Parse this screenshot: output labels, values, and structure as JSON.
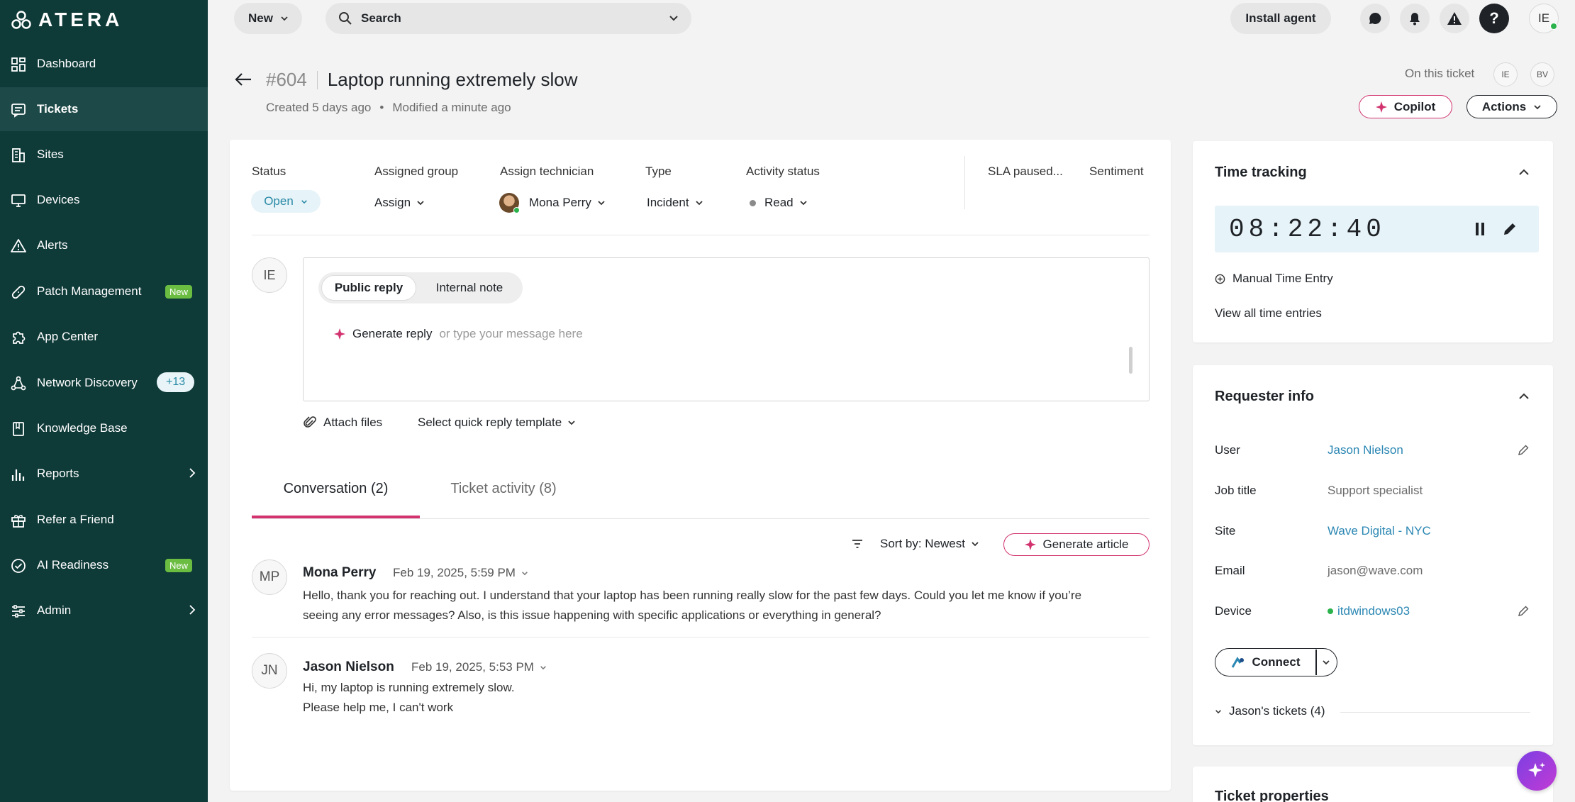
{
  "app": {
    "logo_text": "ATERA"
  },
  "sidebar": {
    "items": [
      {
        "label": "Dashboard"
      },
      {
        "label": "Tickets"
      },
      {
        "label": "Sites"
      },
      {
        "label": "Devices"
      },
      {
        "label": "Alerts"
      },
      {
        "label": "Patch Management",
        "badge": "New"
      },
      {
        "label": "App Center"
      },
      {
        "label": "Network Discovery",
        "badge": "+13"
      },
      {
        "label": "Knowledge Base"
      },
      {
        "label": "Reports"
      },
      {
        "label": "Refer a Friend"
      },
      {
        "label": "AI Readiness",
        "badge": "New"
      },
      {
        "label": "Admin"
      }
    ]
  },
  "topbar": {
    "new_label": "New",
    "search_label": "Search",
    "install_agent": "Install agent",
    "help_glyph": "?",
    "user_initials": "IE"
  },
  "ticket": {
    "number": "#604",
    "title": "Laptop running extremely slow",
    "created": "Created 5 days ago",
    "separator": "•",
    "modified": "Modified a minute ago",
    "on_this_ticket": "On this ticket",
    "viewers": [
      "IE",
      "BV"
    ],
    "copilot": "Copilot",
    "actions": "Actions"
  },
  "fields": {
    "status_label": "Status",
    "status_value": "Open",
    "group_label": "Assigned group",
    "group_value": "Assign",
    "tech_label": "Assign technician",
    "tech_value": "Mona Perry",
    "type_label": "Type",
    "type_value": "Incident",
    "activity_label": "Activity status",
    "activity_value": "Read",
    "sla_label": "SLA paused...",
    "sentiment_label": "Sentiment"
  },
  "reply": {
    "author_initials": "IE",
    "tab_public": "Public reply",
    "tab_internal": "Internal note",
    "generate": "Generate reply",
    "placeholder": "or type your message here",
    "attach": "Attach files",
    "template": "Select quick reply template"
  },
  "conversation": {
    "tab_conv": "Conversation (2)",
    "tab_activity": "Ticket activity (8)",
    "sort": "Sort by: Newest",
    "generate_article": "Generate article",
    "messages": [
      {
        "initials": "MP",
        "name": "Mona Perry",
        "date": "Feb 19, 2025, 5:59 PM",
        "line1": "Hello, thank you for reaching out. I understand that your laptop has been running really slow for the past few days. Could you let me know if you’re",
        "line2": "seeing any error messages? Also, is this issue happening with specific applications or everything in general?"
      },
      {
        "initials": "JN",
        "name": "Jason Nielson",
        "date": "Feb 19, 2025, 5:53 PM",
        "line1": "Hi, my laptop is running extremely slow.",
        "line2": "Please help me, I can't work"
      }
    ]
  },
  "time_tracking": {
    "title": "Time tracking",
    "timer": "08:22:40",
    "manual": "Manual Time Entry",
    "view_all": "View all time entries"
  },
  "requester": {
    "title": "Requester info",
    "user_label": "User",
    "user_value": "Jason Nielson",
    "job_label": "Job title",
    "job_value": "Support specialist",
    "site_label": "Site",
    "site_value": "Wave Digital - NYC",
    "email_label": "Email",
    "email_value": "jason@wave.com",
    "device_label": "Device",
    "device_value": "itdwindows03",
    "connect": "Connect",
    "tickets": "Jason's tickets (4)"
  },
  "properties": {
    "title": "Ticket properties"
  },
  "colors": {
    "sidebar_bg": "#0e3a38",
    "accent_pink": "#d2336f",
    "link_blue": "#2b87b3",
    "status_open": "#2a8aa6",
    "online_green": "#2bb24c"
  }
}
